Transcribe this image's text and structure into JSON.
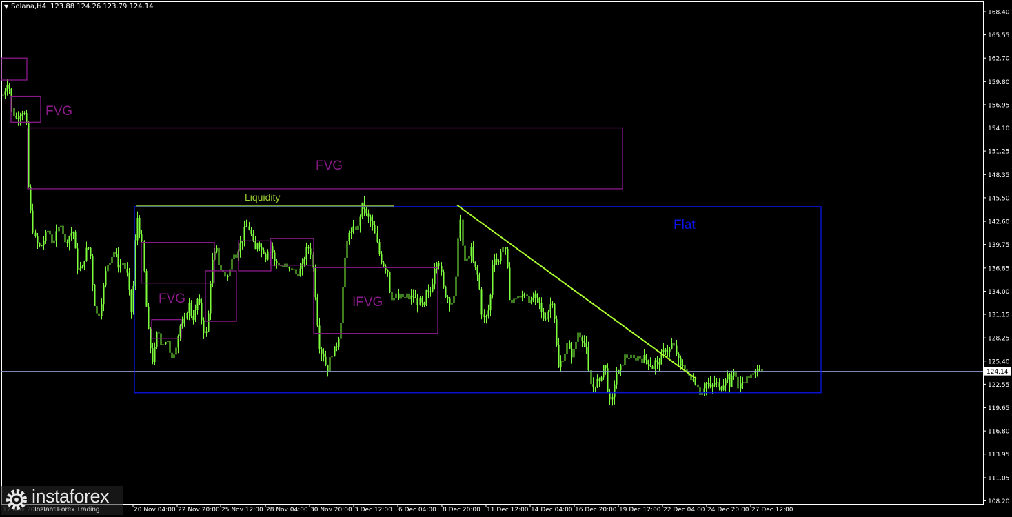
{
  "header": {
    "symbol": "Solana,H4",
    "ohlc": "123.88 124.26 123.79 124.14"
  },
  "logo": {
    "brand": "instaforex",
    "tagline": "Instant Forex Trading"
  },
  "colors": {
    "background": "#000000",
    "candle": "#7CFC3C",
    "zone": "#8B1A8B",
    "flat": "#0A14E6",
    "trendline": "#ADFF2F",
    "price_line": "#8A9CC8",
    "axis_text": "#FFFFFF"
  },
  "chart_data": {
    "type": "candlestick",
    "title": "Solana,H4",
    "ylim": [
      106.5,
      170.5
    ],
    "y_ticks": [
      "168.40",
      "165.55",
      "162.70",
      "159.80",
      "156.95",
      "154.10",
      "151.25",
      "148.35",
      "145.50",
      "142.60",
      "139.75",
      "136.85",
      "134.00",
      "131.15",
      "128.25",
      "125.40",
      "122.55",
      "119.65",
      "116.80",
      "113.95",
      "111.05",
      "108.20"
    ],
    "x_ticks": [
      "20 Nov 04:00",
      "22 Nov 20:00",
      "25 Nov 12:00",
      "28 Nov 04:00",
      "30 Nov 20:00",
      "3 Dec 12:00",
      "6 Dec 04:00",
      "8 Dec 20:00",
      "11 Dec 12:00",
      "14 Dec 04:00",
      "16 Dec 20:00",
      "19 Dec 12:00",
      "22 Dec 04:00",
      "24 Dec 20:00",
      "27 Dec 12:00"
    ],
    "x_tick_partial": "17 Nov 2024 12:00",
    "current_price": "124.14",
    "price_path": [
      [
        0,
        157.5
      ],
      [
        6,
        158.5
      ],
      [
        12,
        160.2
      ],
      [
        16,
        156.5
      ],
      [
        22,
        155.2
      ],
      [
        28,
        155.8
      ],
      [
        34,
        156.2
      ],
      [
        38,
        154.5
      ],
      [
        41,
        147.0
      ],
      [
        46,
        142.0
      ],
      [
        52,
        140.0
      ],
      [
        58,
        139.3
      ],
      [
        64,
        140.5
      ],
      [
        70,
        141.6
      ],
      [
        76,
        140.0
      ],
      [
        82,
        141.1
      ],
      [
        88,
        142.5
      ],
      [
        94,
        139.8
      ],
      [
        100,
        140.8
      ],
      [
        106,
        141.5
      ],
      [
        112,
        137.0
      ],
      [
        118,
        136.5
      ],
      [
        124,
        139.0
      ],
      [
        130,
        139.5
      ],
      [
        136,
        133.0
      ],
      [
        142,
        130.5
      ],
      [
        148,
        133.5
      ],
      [
        154,
        137.0
      ],
      [
        160,
        138.0
      ],
      [
        166,
        139.0
      ],
      [
        172,
        137.0
      ],
      [
        178,
        137.5
      ],
      [
        184,
        136.0
      ],
      [
        190,
        131.5
      ],
      [
        194,
        135.5
      ],
      [
        198,
        143.8
      ],
      [
        203,
        141.0
      ],
      [
        207,
        139.0
      ],
      [
        210,
        134.0
      ],
      [
        214,
        129.5
      ],
      [
        218,
        127.0
      ],
      [
        222,
        125.0
      ],
      [
        226,
        128.5
      ],
      [
        230,
        129.0
      ],
      [
        234,
        127.5
      ],
      [
        238,
        127.8
      ],
      [
        242,
        128.0
      ],
      [
        246,
        126.0
      ],
      [
        250,
        126.0
      ],
      [
        254,
        127.0
      ],
      [
        258,
        128.5
      ],
      [
        262,
        130.0
      ],
      [
        266,
        129.5
      ],
      [
        270,
        131.5
      ],
      [
        274,
        132.5
      ],
      [
        278,
        130.5
      ],
      [
        282,
        131.0
      ],
      [
        286,
        133.0
      ],
      [
        290,
        132.0
      ],
      [
        294,
        129.5
      ],
      [
        298,
        128.5
      ],
      [
        302,
        131.5
      ],
      [
        306,
        137.0
      ],
      [
        310,
        138.5
      ],
      [
        314,
        139.0
      ],
      [
        318,
        137.0
      ],
      [
        322,
        136.5
      ],
      [
        326,
        135.8
      ],
      [
        330,
        136.0
      ],
      [
        334,
        137.0
      ],
      [
        338,
        139.0
      ],
      [
        342,
        138.5
      ],
      [
        346,
        139.5
      ],
      [
        350,
        140.0
      ],
      [
        354,
        141.5
      ],
      [
        358,
        142.0
      ],
      [
        362,
        141.5
      ],
      [
        366,
        140.0
      ],
      [
        370,
        139.0
      ],
      [
        374,
        140.5
      ],
      [
        378,
        139.0
      ],
      [
        382,
        139.0
      ],
      [
        386,
        138.0
      ],
      [
        390,
        140.0
      ],
      [
        394,
        139.0
      ],
      [
        398,
        137.5
      ],
      [
        402,
        137.5
      ],
      [
        406,
        137.2
      ],
      [
        410,
        137.0
      ],
      [
        414,
        137.2
      ],
      [
        418,
        136.5
      ],
      [
        422,
        136.8
      ],
      [
        426,
        136.5
      ],
      [
        430,
        136.0
      ],
      [
        434,
        136.5
      ],
      [
        438,
        137.0
      ],
      [
        442,
        138.5
      ],
      [
        446,
        139.5
      ],
      [
        450,
        139.0
      ],
      [
        454,
        136.5
      ],
      [
        458,
        132.0
      ],
      [
        462,
        127.5
      ],
      [
        466,
        126.5
      ],
      [
        470,
        126.0
      ],
      [
        474,
        124.0
      ],
      [
        478,
        125.5
      ],
      [
        482,
        126.5
      ],
      [
        486,
        127.0
      ],
      [
        490,
        128.0
      ],
      [
        494,
        130.5
      ],
      [
        498,
        136.0
      ],
      [
        502,
        139.5
      ],
      [
        506,
        141.5
      ],
      [
        510,
        141.0
      ],
      [
        514,
        142.0
      ],
      [
        518,
        141.5
      ],
      [
        522,
        143.5
      ],
      [
        526,
        145.0
      ],
      [
        530,
        143.5
      ],
      [
        534,
        143.0
      ],
      [
        538,
        142.5
      ],
      [
        542,
        141.5
      ],
      [
        546,
        140.0
      ],
      [
        550,
        138.5
      ],
      [
        554,
        137.5
      ],
      [
        558,
        137.0
      ],
      [
        562,
        136.5
      ],
      [
        566,
        133.5
      ],
      [
        570,
        133.0
      ],
      [
        574,
        133.5
      ],
      [
        578,
        133.0
      ],
      [
        582,
        133.5
      ],
      [
        586,
        133.0
      ],
      [
        590,
        133.5
      ],
      [
        594,
        133.0
      ],
      [
        598,
        133.5
      ],
      [
        602,
        133.0
      ],
      [
        606,
        132.5
      ],
      [
        610,
        133.0
      ],
      [
        614,
        131.5
      ],
      [
        618,
        134.0
      ],
      [
        622,
        133.5
      ],
      [
        626,
        134.5
      ],
      [
        630,
        137.0
      ],
      [
        634,
        138.0
      ],
      [
        638,
        137.0
      ],
      [
        642,
        134.5
      ],
      [
        646,
        133.5
      ],
      [
        650,
        133.0
      ],
      [
        654,
        132.5
      ],
      [
        658,
        133.0
      ],
      [
        662,
        136.0
      ],
      [
        666,
        144.5
      ],
      [
        670,
        139.5
      ],
      [
        674,
        137.5
      ],
      [
        678,
        138.0
      ],
      [
        682,
        139.5
      ],
      [
        686,
        137.5
      ],
      [
        690,
        136.5
      ],
      [
        694,
        135.5
      ],
      [
        698,
        131.5
      ],
      [
        702,
        130.5
      ],
      [
        706,
        131.0
      ],
      [
        710,
        132.5
      ],
      [
        714,
        137.5
      ],
      [
        718,
        138.5
      ],
      [
        722,
        137.0
      ],
      [
        726,
        139.0
      ],
      [
        730,
        139.5
      ],
      [
        734,
        138.5
      ],
      [
        738,
        133.5
      ],
      [
        742,
        132.5
      ],
      [
        746,
        133.0
      ],
      [
        750,
        133.5
      ],
      [
        754,
        133.0
      ],
      [
        758,
        133.5
      ],
      [
        762,
        134.0
      ],
      [
        766,
        133.0
      ],
      [
        770,
        132.5
      ],
      [
        774,
        133.5
      ],
      [
        778,
        133.0
      ],
      [
        782,
        132.5
      ],
      [
        786,
        131.0
      ],
      [
        790,
        130.5
      ],
      [
        794,
        131.5
      ],
      [
        798,
        132.5
      ],
      [
        802,
        133.0
      ],
      [
        806,
        128.0
      ],
      [
        810,
        124.5
      ],
      [
        814,
        125.5
      ],
      [
        818,
        126.0
      ],
      [
        822,
        127.5
      ],
      [
        826,
        126.5
      ],
      [
        830,
        126.0
      ],
      [
        834,
        127.5
      ],
      [
        838,
        129.0
      ],
      [
        842,
        128.5
      ],
      [
        846,
        128.0
      ],
      [
        850,
        127.0
      ],
      [
        854,
        123.5
      ],
      [
        858,
        122.0
      ],
      [
        862,
        122.5
      ],
      [
        866,
        123.0
      ],
      [
        870,
        122.5
      ],
      [
        874,
        125.0
      ],
      [
        878,
        124.5
      ],
      [
        882,
        121.5
      ],
      [
        886,
        119.5
      ],
      [
        890,
        122.5
      ],
      [
        894,
        124.0
      ],
      [
        898,
        124.0
      ],
      [
        902,
        125.0
      ],
      [
        906,
        126.0
      ],
      [
        910,
        125.8
      ],
      [
        914,
        126.0
      ],
      [
        918,
        125.5
      ],
      [
        922,
        125.8
      ],
      [
        926,
        126.0
      ],
      [
        930,
        125.5
      ],
      [
        934,
        125.8
      ],
      [
        938,
        125.5
      ],
      [
        942,
        125.2
      ],
      [
        946,
        124.5
      ],
      [
        950,
        125.5
      ],
      [
        954,
        124.8
      ],
      [
        958,
        126.0
      ],
      [
        962,
        126.5
      ],
      [
        966,
        127.0
      ],
      [
        970,
        126.5
      ],
      [
        974,
        127.5
      ],
      [
        978,
        127.0
      ],
      [
        982,
        126.0
      ],
      [
        986,
        124.5
      ],
      [
        990,
        125.0
      ],
      [
        994,
        124.5
      ],
      [
        998,
        123.5
      ],
      [
        1002,
        123.0
      ],
      [
        1006,
        123.5
      ],
      [
        1010,
        122.5
      ],
      [
        1014,
        121.5
      ],
      [
        1018,
        121.8
      ],
      [
        1022,
        122.5
      ],
      [
        1026,
        122.8
      ],
      [
        1030,
        122.0
      ],
      [
        1034,
        122.5
      ],
      [
        1038,
        123.0
      ],
      [
        1042,
        122.0
      ],
      [
        1046,
        122.2
      ],
      [
        1050,
        123.0
      ],
      [
        1054,
        124.0
      ],
      [
        1058,
        122.5
      ],
      [
        1062,
        123.5
      ],
      [
        1066,
        124.5
      ],
      [
        1070,
        122.0
      ],
      [
        1074,
        122.5
      ],
      [
        1078,
        123.0
      ],
      [
        1082,
        123.2
      ],
      [
        1086,
        123.5
      ],
      [
        1090,
        123.5
      ],
      [
        1094,
        123.8
      ],
      [
        1098,
        124.5
      ],
      [
        1102,
        124.8
      ],
      [
        1106,
        124.1
      ]
    ],
    "zones": [
      {
        "label": "",
        "y_top": 162.7,
        "y_bottom": 160.0
      },
      {
        "label": "FVG",
        "y_top": 158.0,
        "y_bottom": 154.8
      },
      {
        "label": "FVG",
        "y_top": 154.1,
        "y_bottom": 146.6
      },
      {
        "label": "FVG",
        "y_top": 140.0,
        "y_bottom": 135.0
      },
      {
        "label": "",
        "y_top": 136.5,
        "y_bottom": 130.3
      },
      {
        "label": "",
        "y_top": 130.5,
        "y_bottom": 128.2
      },
      {
        "label": "",
        "y_top": 140.2,
        "y_bottom": 136.5
      },
      {
        "label": "",
        "y_top": 140.5,
        "y_bottom": 137.2
      },
      {
        "label": "IFVG",
        "y_top": 136.9,
        "y_bottom": 128.8
      }
    ],
    "flat_range": {
      "label": "Flat",
      "y_top": 144.4,
      "y_bottom": 121.5
    },
    "liquidity": {
      "label": "Liquidity",
      "level": 144.4
    },
    "trendline": {
      "from": 144.6,
      "to": 123.2
    }
  }
}
